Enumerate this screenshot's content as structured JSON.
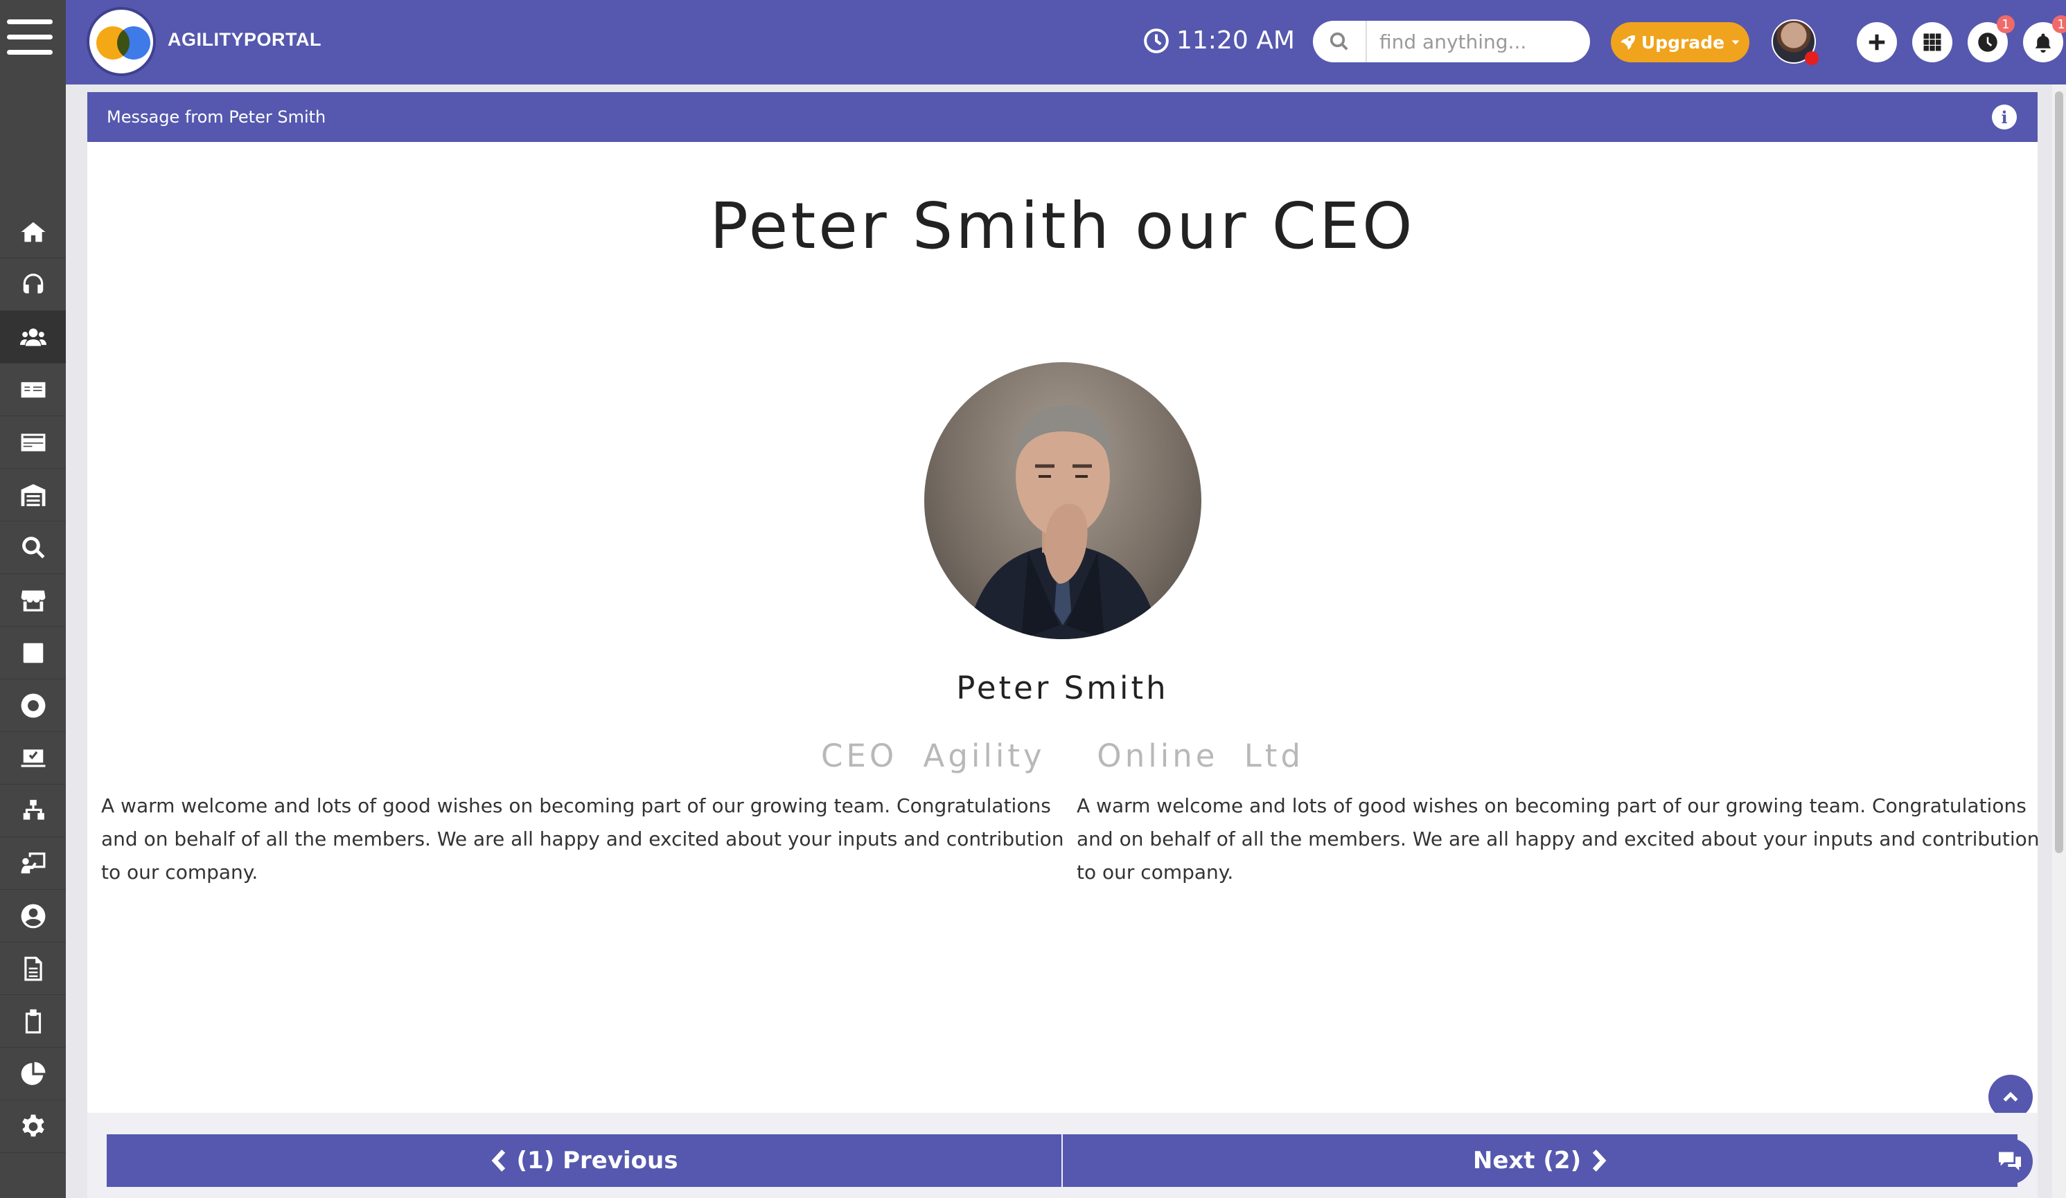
{
  "app": {
    "brand": "AGILITYPORTAL",
    "time": "11:20 AM"
  },
  "search": {
    "placeholder": "find anything..."
  },
  "header_actions": {
    "upgrade_label": "Upgrade",
    "history_badge": "1",
    "notifications_badge": "1"
  },
  "sidebar": {
    "items": [
      {
        "name": "home"
      },
      {
        "name": "support"
      },
      {
        "name": "people"
      },
      {
        "name": "payroll"
      },
      {
        "name": "cards"
      },
      {
        "name": "institution"
      },
      {
        "name": "search-finance"
      },
      {
        "name": "store"
      },
      {
        "name": "square"
      },
      {
        "name": "settings-badge"
      },
      {
        "name": "inbox"
      },
      {
        "name": "org-chart"
      },
      {
        "name": "presentation"
      },
      {
        "name": "user"
      },
      {
        "name": "document"
      },
      {
        "name": "clipboard"
      },
      {
        "name": "pie-chart"
      },
      {
        "name": "settings"
      }
    ]
  },
  "panel": {
    "title": "Message from Peter Smith",
    "heading": "Peter Smith our CEO",
    "person_name": "Peter Smith",
    "person_title": "CEO Agility  Online Ltd",
    "message_left": "A warm welcome and lots of good wishes on becoming part of our growing team. Congratulations and on behalf of all the members. We are all happy and excited about your inputs and contribution to our company.",
    "message_right": "A warm welcome and lots of good wishes on becoming part of our growing team. Congratulations and on behalf of all the members. We are all happy and excited about your inputs and contribution to our company."
  },
  "navigation": {
    "previous_label": "(1) Previous",
    "next_label": "Next (2)"
  },
  "colors": {
    "primary": "#5558ae",
    "sidebar": "#454545",
    "upgrade": "#f0a31c",
    "badge": "#f06a6a"
  }
}
